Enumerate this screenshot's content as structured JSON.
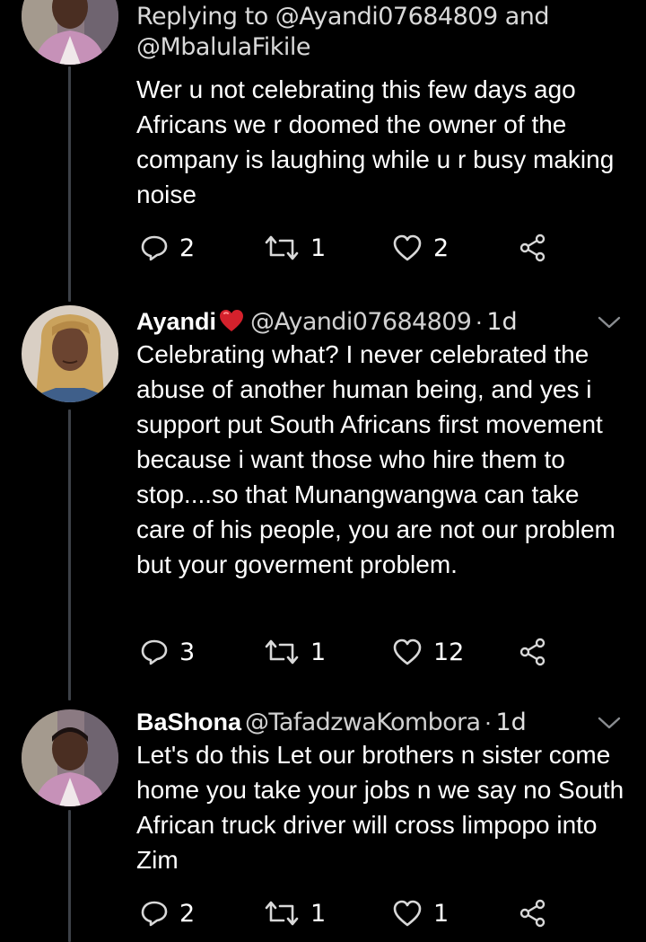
{
  "colors": {
    "background": "#000000",
    "text": "#ffffff",
    "muted": "#d0d0d0",
    "thread_line": "#3d4148",
    "icon": "#d8d8d8"
  },
  "tweets": [
    {
      "reply_to": "Replying to @Ayandi07684809 and @MbalulaFikile",
      "text": "Wer u not celebrating this few days ago Africans we r doomed the owner of the company is laughing while u r busy making noise",
      "actions": {
        "replies": "2",
        "retweets": "1",
        "likes": "2"
      },
      "icons": [
        "reply-icon",
        "retweet-icon",
        "like-icon",
        "share-icon"
      ]
    },
    {
      "display_name": "Ayandi",
      "name_emoji": "red-heart",
      "handle": "@Ayandi07684809",
      "separator": "·",
      "time": "1d",
      "text": "Celebrating what? I never celebrated the abuse of another human being, and yes i support put South Africans first movement because i want those who hire them to stop....so that Munangwangwa can take care of his people, you are not our problem but your goverment problem.",
      "actions": {
        "replies": "3",
        "retweets": "1",
        "likes": "12"
      }
    },
    {
      "display_name": "BaShona",
      "handle": "@TafadzwaKombora",
      "separator": "·",
      "time": "1d",
      "text": "Let's do this Let our brothers n sister come home you take your jobs n we say no  South African truck driver will cross limpopo into Zim",
      "actions": {
        "replies": "2",
        "retweets": "1",
        "likes": "1"
      }
    }
  ]
}
